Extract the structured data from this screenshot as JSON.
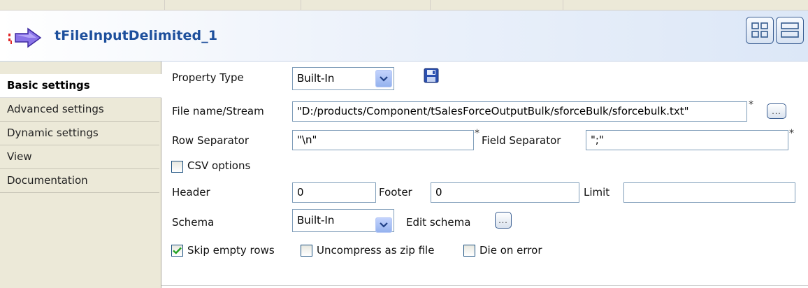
{
  "component": {
    "title": "tFileInputDelimited_1",
    "icon": "file-input-delimited-icon",
    "layout_buttons": [
      "grid-layout-icon",
      "list-layout-icon"
    ]
  },
  "tabs": [
    {
      "label": "Basic settings",
      "active": true
    },
    {
      "label": "Advanced settings",
      "active": false
    },
    {
      "label": "Dynamic settings",
      "active": false
    },
    {
      "label": "View",
      "active": false
    },
    {
      "label": "Documentation",
      "active": false
    }
  ],
  "form": {
    "property_type": {
      "label": "Property Type",
      "value": "Built-In",
      "save_icon": "floppy-disk-icon"
    },
    "file_name": {
      "label": "File name/Stream",
      "value": "\"D:/products/Component/tSalesForceOutputBulk/sforceBulk/sforcebulk.txt\"",
      "required": "*",
      "browse": "..."
    },
    "row_separator": {
      "label": "Row Separator",
      "value": "\"\\n\"",
      "required": "*"
    },
    "field_separator": {
      "label": "Field Separator",
      "value": "\";\"",
      "required": "*"
    },
    "csv_options": {
      "label": "CSV options",
      "checked": false
    },
    "header": {
      "label": "Header",
      "value": "0"
    },
    "footer": {
      "label": "Footer",
      "value": "0"
    },
    "limit": {
      "label": "Limit",
      "value": ""
    },
    "schema": {
      "label": "Schema",
      "value": "Built-In"
    },
    "edit_schema": {
      "label": "Edit schema",
      "button": "..."
    },
    "skip_empty_rows": {
      "label": "Skip empty rows",
      "checked": true
    },
    "uncompress_zip": {
      "label": "Uncompress as zip file",
      "checked": false
    },
    "die_on_error": {
      "label": "Die on error",
      "checked": false
    }
  },
  "colors": {
    "title": "#1d4f9c",
    "accent_arrow": "#6a4fd6",
    "check": "#21a121"
  }
}
